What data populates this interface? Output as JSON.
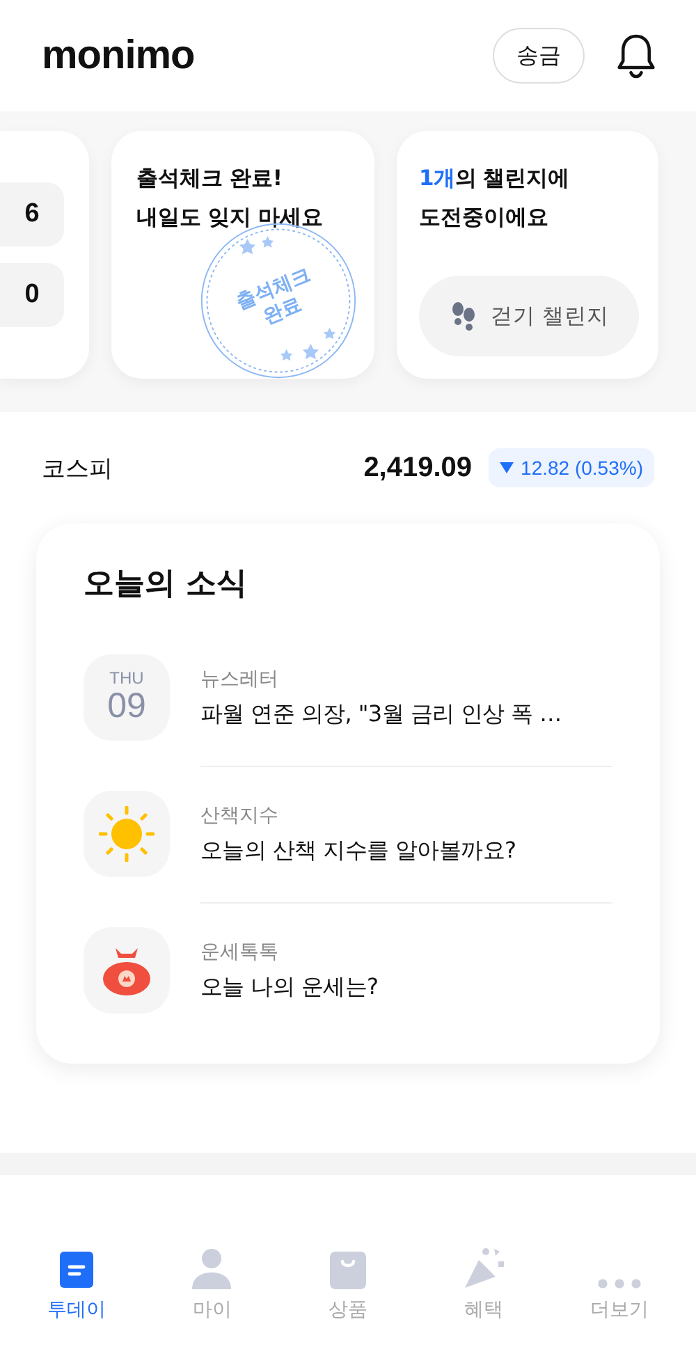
{
  "header": {
    "logo": "monimo",
    "transfer_button": "송금"
  },
  "cards": [
    {
      "kind": "counts",
      "values": [
        "6",
        "0"
      ]
    },
    {
      "kind": "attendance",
      "title_lines": [
        "출석체크 완료!",
        "내일도 잊지 마세요"
      ],
      "stamp_lines": [
        "출석체크",
        "완료"
      ]
    },
    {
      "kind": "challenge",
      "highlight": "1개",
      "title_rest": "의 챌린지에",
      "title_line2": "도전중이에요",
      "button": "걷기 챌린지"
    }
  ],
  "index": {
    "name": "코스피",
    "value": "2,419.09",
    "down": true,
    "change": "12.82 (0.53%)"
  },
  "news": {
    "title": "오늘의 소식",
    "items": [
      {
        "kind": "date",
        "weekday": "THU",
        "day": "09",
        "category": "뉴스레터",
        "text": "파월 연준 의장, \"3월 금리 인상 폭 …"
      },
      {
        "kind": "sun",
        "category": "산책지수",
        "text": "오늘의 산책 지수를 알아볼까요?"
      },
      {
        "kind": "pouch",
        "category": "운세톡톡",
        "text": "오늘 나의 운세는?"
      }
    ]
  },
  "tabs": [
    {
      "kind": "today",
      "label": "투데이",
      "selected": true
    },
    {
      "kind": "my",
      "label": "마이",
      "selected": false
    },
    {
      "kind": "products",
      "label": "상품",
      "selected": false
    },
    {
      "kind": "benefits",
      "label": "혜택",
      "selected": false
    },
    {
      "kind": "more",
      "label": "더보기",
      "selected": false
    }
  ]
}
